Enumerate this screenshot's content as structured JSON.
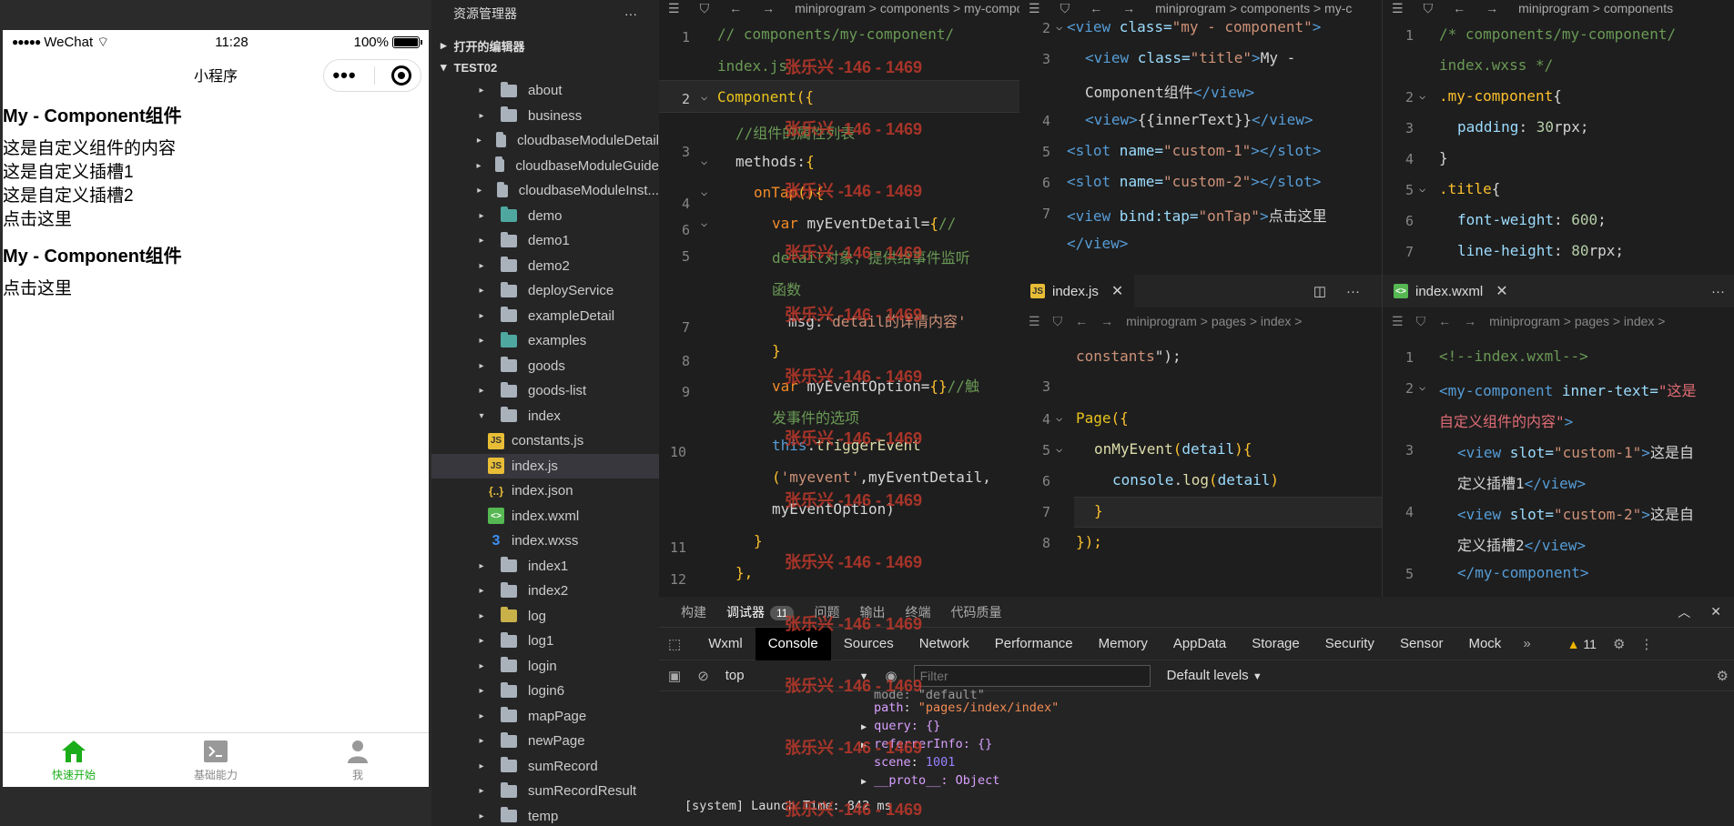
{
  "simulator": {
    "status": {
      "carrier": "WeChat",
      "time": "11:28",
      "battery": "100%"
    },
    "nav_title": "小程序",
    "page": {
      "title1": "My - Component组件",
      "line1": "这是自定义组件的内容",
      "line2": "这是自定义插槽1",
      "line3": "这是自定义插槽2",
      "line4": "点击这里",
      "title2": "My - Component组件",
      "line5": "点击这里"
    },
    "tabbar": [
      {
        "label": "快速开始",
        "icon": "home-icon"
      },
      {
        "label": "基础能力",
        "icon": "terminal-icon"
      },
      {
        "label": "我",
        "icon": "user-icon"
      }
    ]
  },
  "explorer": {
    "title": "资源管理器",
    "section_open": "打开的编辑器",
    "section_project": "TEST02",
    "folders_top": [
      "about",
      "business",
      "cloudbaseModuleDetail",
      "cloudbaseModuleGuide",
      "cloudbaseModuleInst...",
      "demo",
      "demo1",
      "demo2",
      "deployService",
      "exampleDetail",
      "examples",
      "goods",
      "goods-list",
      "index"
    ],
    "index_files": [
      "constants.js",
      "index.js",
      "index.json",
      "index.wxml",
      "index.wxss"
    ],
    "folders_bottom": [
      "index1",
      "index2",
      "log",
      "log1",
      "login",
      "login6",
      "mapPage",
      "newPage",
      "sumRecord",
      "sumRecordResult",
      "temp"
    ]
  },
  "editor1": {
    "breadcrumb": "miniprogram > components > my-compo",
    "line_numbers": [
      "1",
      "2",
      "3",
      "4",
      "5",
      "6",
      "7",
      "8",
      "9",
      "10",
      "11",
      "12"
    ]
  },
  "editor2": {
    "breadcrumb": "miniprogram > components > my-c"
  },
  "editor3": {
    "breadcrumb": "miniprogram > components"
  },
  "editor4": {
    "tab": "index.js",
    "breadcrumb": "miniprogram > pages > index >"
  },
  "editor5": {
    "tab": "index.wxml",
    "breadcrumb": "miniprogram > pages > index >"
  },
  "watermark": "张乐兴 -146 - 1469",
  "devtools": {
    "top_tabs": [
      "构建",
      "调试器",
      "问题",
      "输出",
      "终端",
      "代码质量"
    ],
    "debugger_badge": "11",
    "panel_tabs": [
      "Wxml",
      "Console",
      "Sources",
      "Network",
      "Performance",
      "Memory",
      "AppData",
      "Storage",
      "Security",
      "Sensor",
      "Mock"
    ],
    "warnings": "11",
    "context": "top",
    "filter_placeholder": "Filter",
    "levels": "Default levels",
    "console_lines": {
      "mode": "mode: \"default\"",
      "path_key": "path",
      "path_val": "\"pages/index/index\"",
      "query": "query: {}",
      "referrer": "referrerInfo: {}",
      "scene_key": "scene",
      "scene_val": "1001",
      "proto": "__proto__: Object",
      "launch": "[system] Launch Time: 842 ms"
    }
  }
}
